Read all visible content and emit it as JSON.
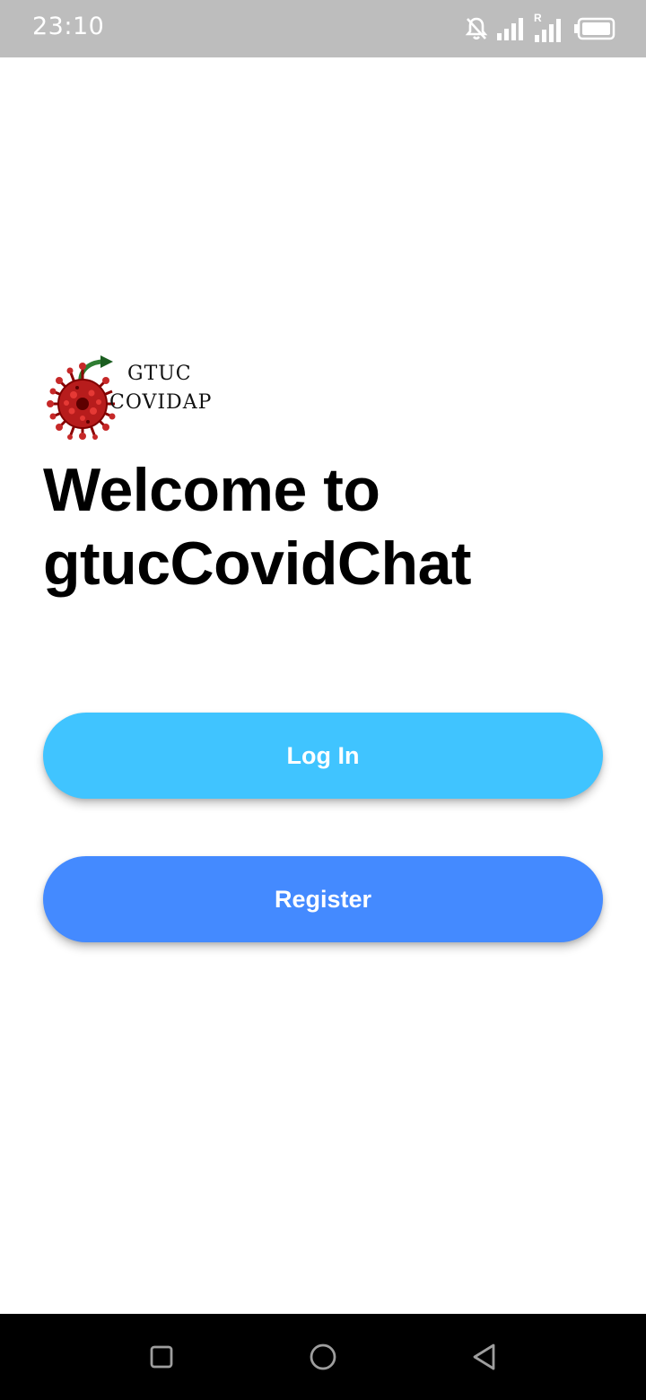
{
  "status_bar": {
    "time": "23:10",
    "icons": [
      "notifications-off-icon",
      "signal-icon",
      "signal-roaming-icon",
      "battery-icon"
    ],
    "roaming_label": "R",
    "background": "#bdbdbd"
  },
  "logo": {
    "line1": "GTUC",
    "line2": "COVIDAP",
    "icon": "coronavirus-logo-icon"
  },
  "welcome": {
    "line1": "Welcome to",
    "line2": "gtucCovidChat"
  },
  "buttons": {
    "login_label": "Log In",
    "register_label": "Register",
    "login_color": "#40c4ff",
    "register_color": "#448aff"
  },
  "nav_bar": {
    "icons": [
      "recents-square-icon",
      "home-circle-icon",
      "back-triangle-icon"
    ]
  }
}
